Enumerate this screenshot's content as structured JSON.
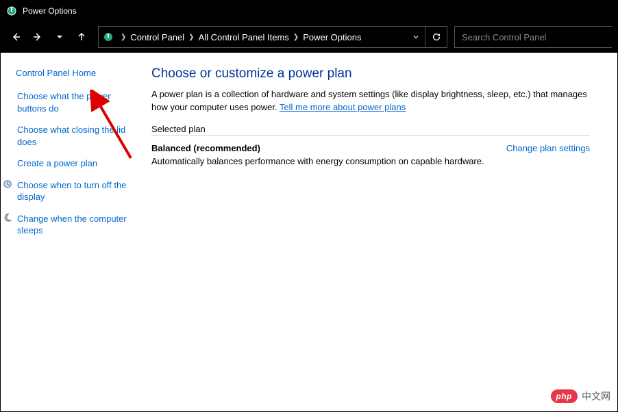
{
  "window": {
    "title": "Power Options"
  },
  "breadcrumb": {
    "items": [
      "Control Panel",
      "All Control Panel Items",
      "Power Options"
    ]
  },
  "search": {
    "placeholder": "Search Control Panel"
  },
  "sidebar": {
    "home": "Control Panel Home",
    "links": [
      {
        "label": "Choose what the power buttons do",
        "icon": false
      },
      {
        "label": "Choose what closing the lid does",
        "icon": false
      },
      {
        "label": "Create a power plan",
        "icon": false
      },
      {
        "label": "Choose when to turn off the display",
        "icon": true,
        "iconType": "clock"
      },
      {
        "label": "Change when the computer sleeps",
        "icon": true,
        "iconType": "moon"
      }
    ]
  },
  "main": {
    "heading": "Choose or customize a power plan",
    "desc_pre": "A power plan is a collection of hardware and system settings (like display brightness, sleep, etc.) that manages how your computer uses power. ",
    "desc_link": "Tell me more about power plans",
    "section_label": "Selected plan",
    "plan_name": "Balanced (recommended)",
    "plan_desc": "Automatically balances performance with energy consumption on capable hardware.",
    "change_link": "Change plan settings"
  },
  "watermark": {
    "badge": "php",
    "text": "中文网"
  }
}
